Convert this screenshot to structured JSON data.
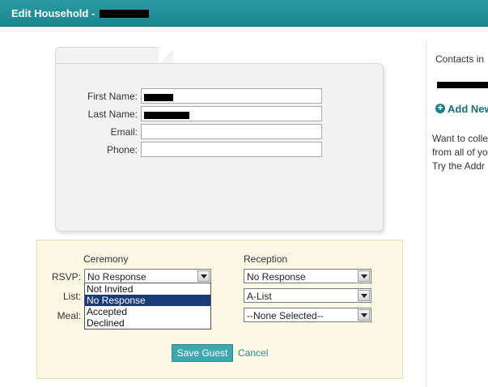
{
  "window": {
    "title": "Edit Household -"
  },
  "contact": {
    "fields": [
      {
        "label": "First Name:",
        "value": ""
      },
      {
        "label": "Last Name:",
        "value": ""
      },
      {
        "label": "Email:",
        "value": ""
      },
      {
        "label": "Phone:",
        "value": ""
      }
    ]
  },
  "rsvp": {
    "ceremony_heading": "Ceremony",
    "reception_heading": "Reception",
    "rows": [
      {
        "label": "RSVP:",
        "ceremony_value": "No Response",
        "reception_value": "No Response"
      },
      {
        "label": "List:",
        "ceremony_value": "",
        "reception_value": "A-List"
      },
      {
        "label": "Meal:",
        "ceremony_value": "",
        "reception_value": "--None Selected--"
      }
    ],
    "open_dropdown": {
      "options": [
        "Not Invited",
        "No Response",
        "Accepted",
        "Declined"
      ],
      "highlighted": "No Response"
    }
  },
  "actions": {
    "save_label": "Save Guest",
    "cancel_label": "Cancel"
  },
  "sidebar": {
    "contacts_text": "Contacts in",
    "add_label": "Add New",
    "info_lines": [
      "Want to colle",
      "from all of yo",
      "Try the Addr"
    ]
  },
  "colors": {
    "header": "#1b8790",
    "accent": "#3fa7ad",
    "highlight": "#1a3a7a"
  },
  "icons": {
    "add": "plus-circle-icon",
    "dropdown": "chevron-down-icon"
  }
}
